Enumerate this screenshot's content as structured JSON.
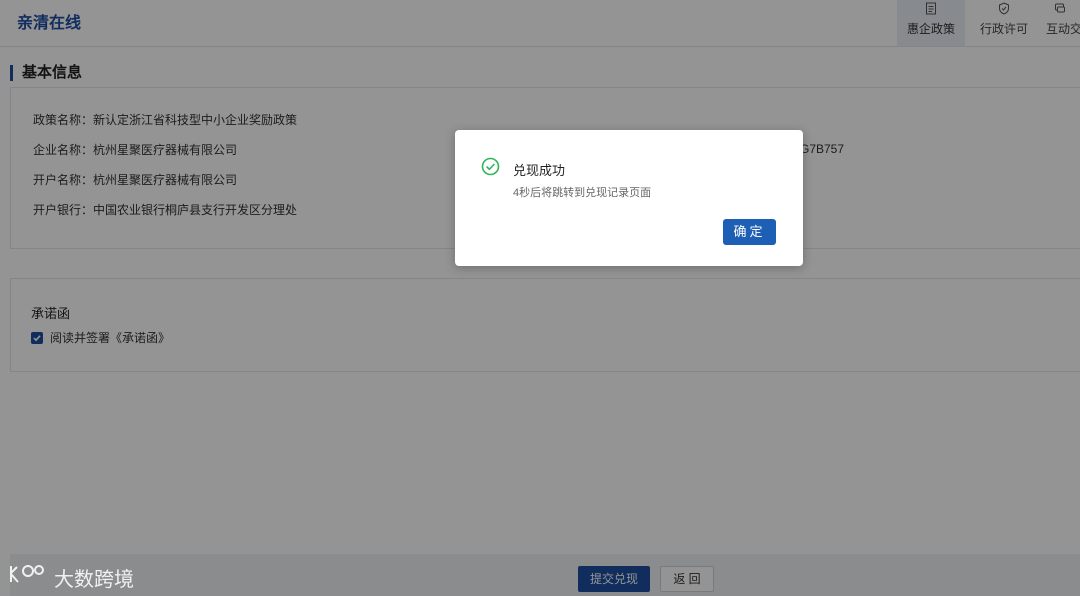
{
  "header": {
    "brand": "亲清在线",
    "nav": [
      {
        "label": "惠企政策",
        "icon": "document-icon",
        "active": true
      },
      {
        "label": "行政许可",
        "icon": "shield-icon",
        "active": false
      },
      {
        "label": "互动交",
        "icon": "chat-icon",
        "active": false
      }
    ]
  },
  "main": {
    "section_title": "基本信息",
    "info": [
      {
        "key": "政策名称：",
        "value": "新认定浙江省科技型中小企业奖励政策"
      },
      {
        "key": "企业名称：",
        "value": "杭州星聚医疗器械有限公司"
      },
      {
        "key": "开户名称：",
        "value": "杭州星聚医疗器械有限公司"
      },
      {
        "key": "开户银行：",
        "value": "中国农业银行桐庐县支行开发区分理处"
      }
    ],
    "partial_code": "G7B757",
    "promise": {
      "title": "承诺函",
      "checkbox_label": "阅读并签署《承诺函》",
      "checked": true
    },
    "footer": {
      "submit_label": "提交兑现",
      "back_label": "返 回"
    }
  },
  "dialog": {
    "title": "兑现成功",
    "message": "4秒后将跳转到兑现记录页面",
    "ok_label": "确定",
    "icon": "success-check-icon"
  },
  "watermark": {
    "text": "大数跨境",
    "icon": "logo-icon"
  },
  "colors": {
    "brand": "#1d4fa3",
    "success": "#2fb45a",
    "primary_button": "#1d5fb5"
  }
}
